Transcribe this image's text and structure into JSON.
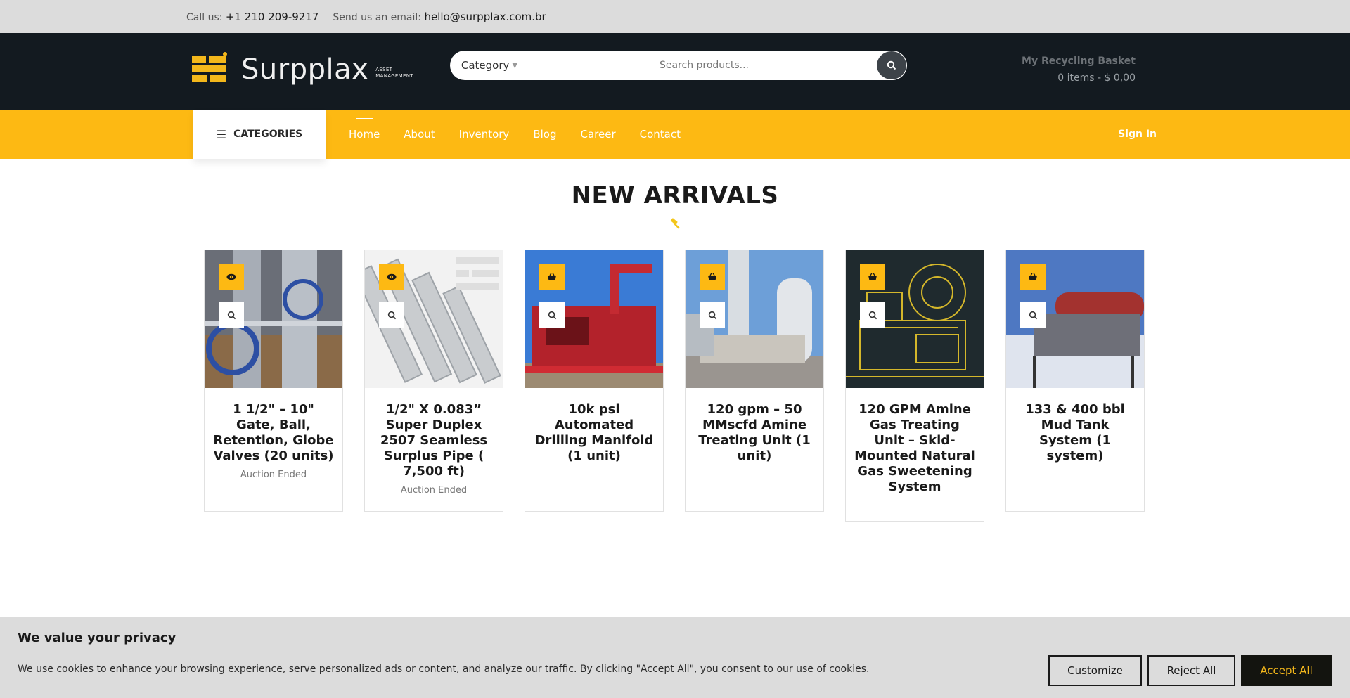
{
  "topbar": {
    "call_label": "Call us:",
    "phone": "+1 210 209-9217",
    "email_label": "Send us an email:",
    "email": "hello@surpplax.com.br"
  },
  "header": {
    "logo_text": "Surpplax",
    "logo_sub_1": "ASSET",
    "logo_sub_2": "MANAGEMENT",
    "category_label": "Category",
    "search_placeholder": "Search products...",
    "basket_title": "My Recycling Basket",
    "basket_summary": "0 items - $ 0,00"
  },
  "nav": {
    "categories_label": "CATEGORIES",
    "links": [
      "Home",
      "About",
      "Inventory",
      "Blog",
      "Career",
      "Contact"
    ],
    "signin": "Sign In"
  },
  "section": {
    "title": "NEW ARRIVALS"
  },
  "products": [
    {
      "title": "1 1/2\" – 10\" Gate, Ball, Retention, Globe Valves (20 units)",
      "status": "Auction Ended",
      "action_icon": "eye-icon"
    },
    {
      "title": "1/2\" X 0.083” Super Duplex 2507 Seamless Surplus Pipe ( 7,500 ft)",
      "status": "Auction Ended",
      "action_icon": "eye-icon"
    },
    {
      "title": "10k psi Automated Drilling Manifold (1 unit)",
      "status": "",
      "action_icon": "basket-icon"
    },
    {
      "title": "120 gpm – 50 MMscfd Amine Treating Unit (1 unit)",
      "status": "",
      "action_icon": "basket-icon"
    },
    {
      "title": "120 GPM Amine Gas Treating Unit – Skid-Mounted Natural Gas Sweetening System",
      "status": "",
      "action_icon": "basket-icon"
    },
    {
      "title": "133 & 400 bbl Mud Tank System (1 system)",
      "status": "",
      "action_icon": "basket-icon"
    }
  ],
  "cookie": {
    "title": "We value your privacy",
    "text": "We use cookies to enhance your browsing experience, serve personalized ads or content, and analyze our traffic. By clicking \"Accept All\", you consent to our use of cookies.",
    "customize": "Customize",
    "reject": "Reject All",
    "accept": "Accept All"
  },
  "colors": {
    "accent": "#fdb913",
    "header_bg": "#131a20",
    "topbar_bg": "#dcdcdc"
  }
}
